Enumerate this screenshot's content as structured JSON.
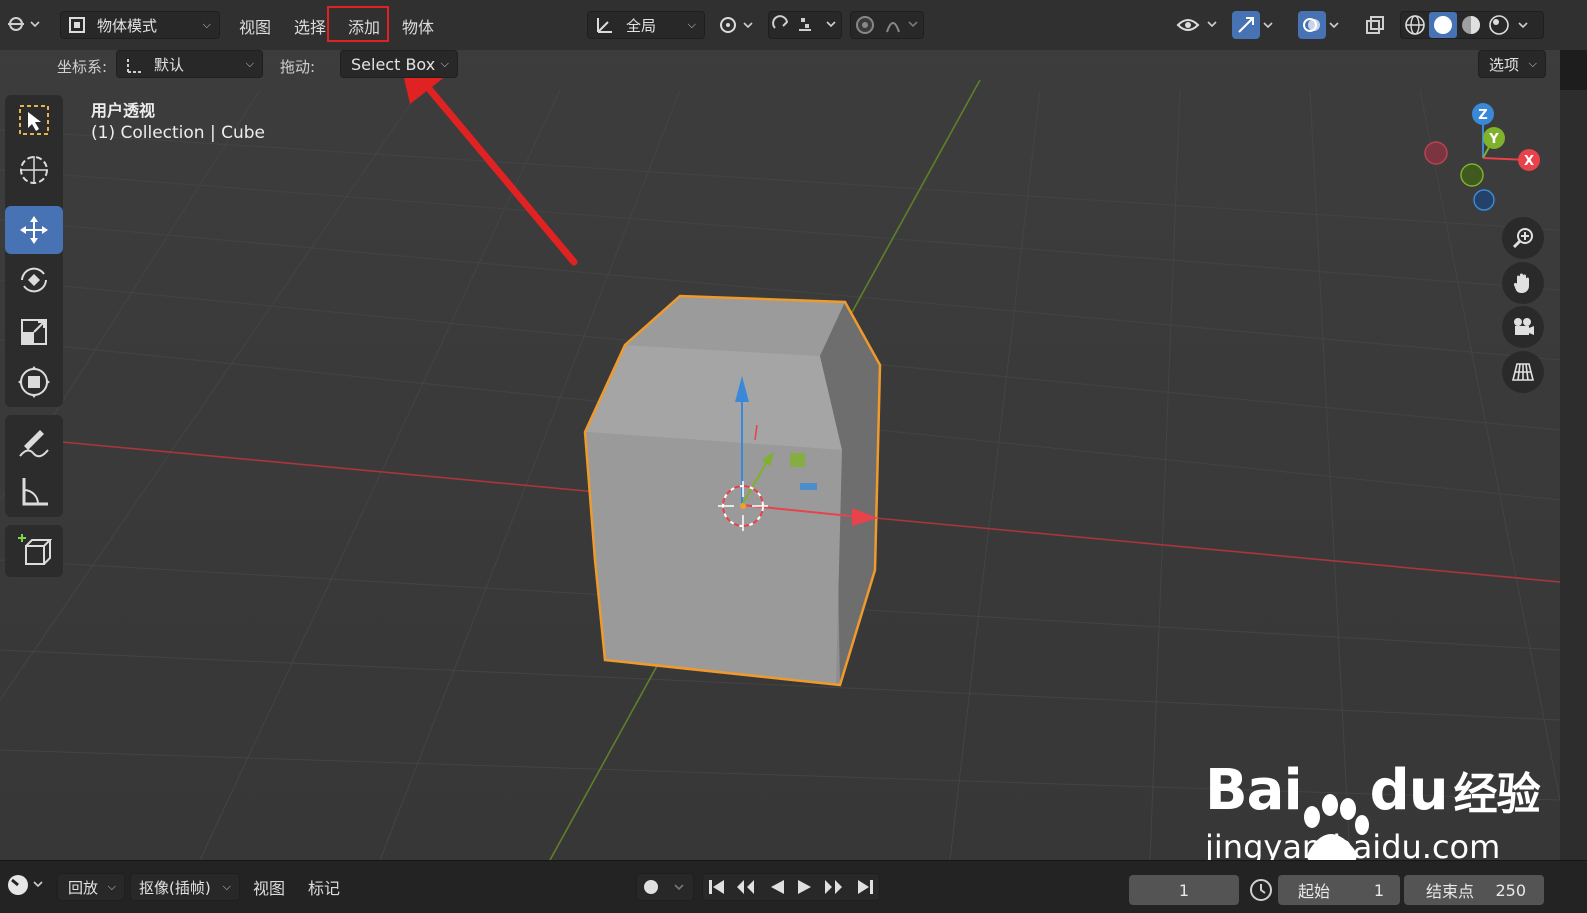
{
  "header": {
    "mode_label": "物体模式",
    "menus": [
      "视图",
      "选择",
      "添加",
      "物体"
    ],
    "transform_orientation": "全局",
    "options_label": "选项"
  },
  "toolbar_row": {
    "coord_label": "坐标系:",
    "coord_value": "默认",
    "drag_label": "拖动:",
    "drag_value": "Select Box"
  },
  "viewport": {
    "view_name": "用户透视",
    "collection_info": "(1) Collection | Cube",
    "gizmo_axes": [
      "Z",
      "Y",
      "X"
    ]
  },
  "timeline": {
    "menus": [
      "回放",
      "抠像(插帧)",
      "视图",
      "标记"
    ],
    "current_frame": "1",
    "start_label": "起始",
    "start_value": "1",
    "end_label": "结束点",
    "end_value": "250"
  },
  "watermark": {
    "brand": "Bai",
    "brand2": "du",
    "brand_cn": "经验",
    "url": "jingyan.baidu.com"
  },
  "colors": {
    "accent": "#4772b3",
    "selection_outline": "#f09a2c",
    "x_axis": "#e8424b",
    "y_axis": "#7fb12a",
    "z_axis": "#3a89d8",
    "highlight_box": "#e02222"
  },
  "icons": [
    "editor-type-icon",
    "object-mode-icon",
    "transform-orientation-icon",
    "pivot-icon",
    "snap-icon",
    "proportional-edit-icon",
    "visibility-icon",
    "gizmo-icon",
    "overlay-icon",
    "xray-icon",
    "wireframe-shading-icon",
    "solid-shading-icon",
    "material-shading-icon",
    "rendered-shading-icon",
    "select-box-icon",
    "cursor-icon",
    "move-icon",
    "rotate-icon",
    "scale-icon",
    "transform-icon",
    "annotate-icon",
    "measure-icon",
    "add-cube-icon",
    "zoom-icon",
    "hand-icon",
    "camera-icon",
    "grid-view-icon",
    "clock-icon",
    "record-icon",
    "jump-start-icon",
    "prev-keyframe-icon",
    "play-reverse-icon",
    "play-icon",
    "next-keyframe-icon",
    "jump-end-icon"
  ]
}
